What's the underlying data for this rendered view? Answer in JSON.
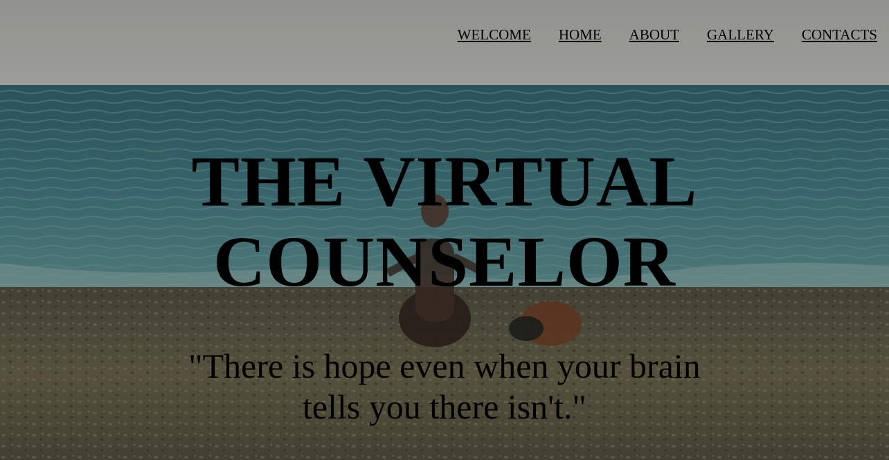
{
  "nav": {
    "items": [
      {
        "label": "WELCOME"
      },
      {
        "label": "HOME"
      },
      {
        "label": "ABOUT"
      },
      {
        "label": "GALLERY"
      },
      {
        "label": "CONTACTS"
      }
    ]
  },
  "hero": {
    "title_line1": "THE VIRTUAL",
    "title_line2": "COUNSELOR",
    "quote": "\"There is hope even when your brain tells you there isn't.\""
  },
  "colors": {
    "sky": "#a7a8a3",
    "sea": "#3f6f73",
    "shore": "#5d5a45",
    "text": "#000000"
  }
}
